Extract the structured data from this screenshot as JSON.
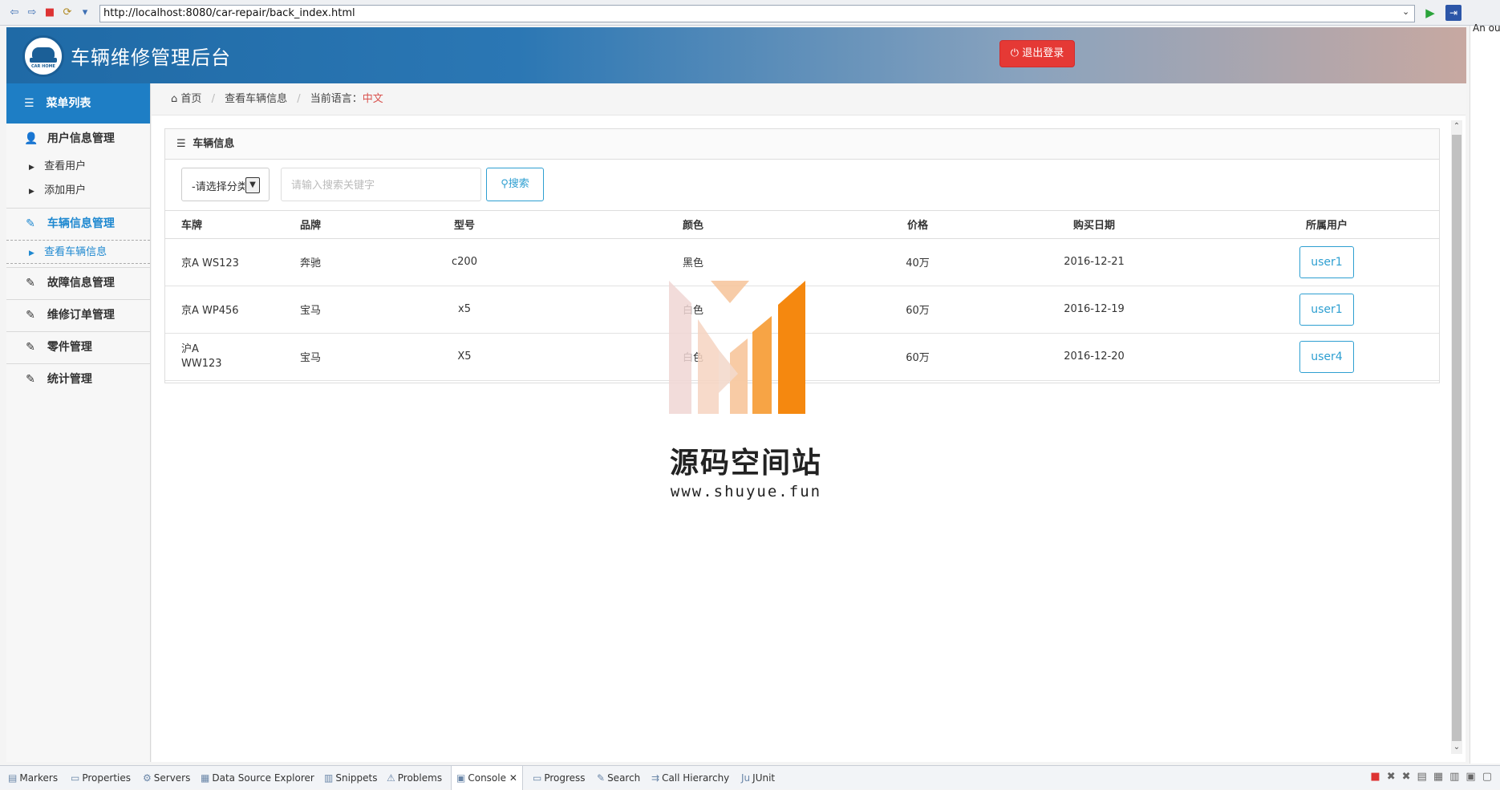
{
  "browser": {
    "url": "http://localhost:8080/car-repair/back_index.html",
    "side_note": "An ou"
  },
  "header": {
    "logo_text": "CAR HOME",
    "title": "车辆维修管理后台",
    "logout_label": "退出登录"
  },
  "sidebar": {
    "menu_title": "菜单列表",
    "groups": [
      {
        "label": "用户信息管理",
        "icon": "user-icon",
        "subs": [
          "查看用户",
          "添加用户"
        ]
      },
      {
        "label": "车辆信息管理",
        "icon": "edit-icon",
        "subs": [
          "查看车辆信息"
        ]
      },
      {
        "label": "故障信息管理",
        "icon": "edit-icon"
      },
      {
        "label": "维修订单管理",
        "icon": "edit-icon"
      },
      {
        "label": "零件管理",
        "icon": "edit-icon"
      },
      {
        "label": "统计管理",
        "icon": "edit-icon"
      }
    ]
  },
  "breadcrumb": {
    "home": "首页",
    "current": "查看车辆信息",
    "lang_label": "当前语言：",
    "lang_value": "中文"
  },
  "panel": {
    "title": "车辆信息",
    "category_select": "-请选择分类-",
    "search_placeholder": "请输入搜索关键字",
    "search_label": "搜索"
  },
  "table": {
    "headers": [
      "车牌",
      "品牌",
      "型号",
      "颜色",
      "价格",
      "购买日期",
      "所属用户"
    ],
    "rows": [
      [
        "京A WS123",
        "奔驰",
        "c200",
        "黑色",
        "40万",
        "2016-12-21",
        "user1"
      ],
      [
        "京A WP456",
        "宝马",
        "x5",
        "白色",
        "60万",
        "2016-12-19",
        "user1"
      ],
      [
        "沪A WW123",
        "宝马",
        "X5",
        "白色",
        "60万",
        "2016-12-20",
        "user4"
      ]
    ]
  },
  "watermark": {
    "text": "源码空间站",
    "url": "www.shuyue.fun"
  },
  "ide_tabs": [
    "Markers",
    "Properties",
    "Servers",
    "Data Source Explorer",
    "Snippets",
    "Problems",
    "Console",
    "Progress",
    "Search",
    "Call Hierarchy",
    "JUnit"
  ],
  "colors": {
    "primary": "#1e7ec5",
    "danger": "#e53935",
    "link": "#2e9fd1"
  }
}
